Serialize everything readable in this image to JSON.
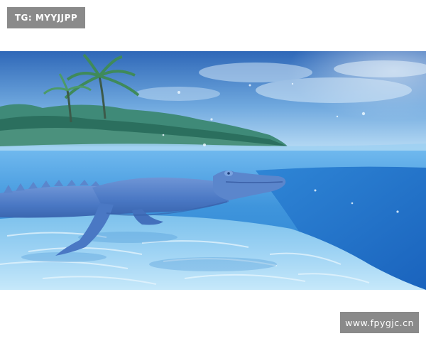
{
  "watermarks": {
    "top_left": "TG: MYYJJPP",
    "bottom_right": "www.fpygjc.cn"
  },
  "scene": {
    "subject": "crocodile",
    "colors": {
      "sky_top": "#2f6fc0",
      "sky_bottom": "#a9d4f3",
      "water_surface": "#5aa9e6",
      "water_deep": "#1f6fc4",
      "sand_light": "#bfe3f8",
      "sand_mid": "#66b4e6",
      "crocodile": "#4f7ec8",
      "island": "#2f7a6a"
    }
  }
}
